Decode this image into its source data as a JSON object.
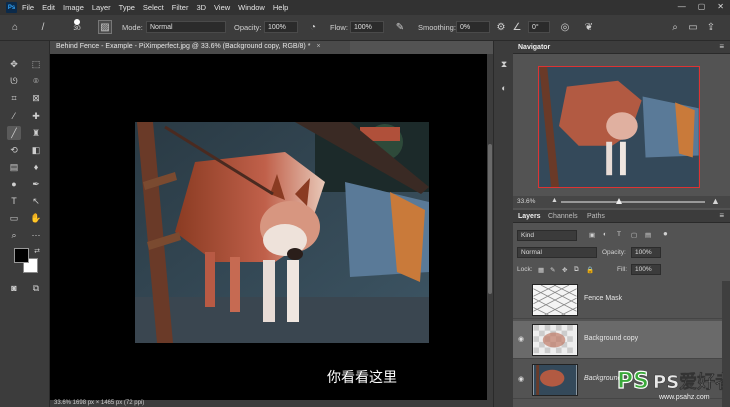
{
  "menubar": {
    "logo": "Ps",
    "items": [
      "File",
      "Edit",
      "Image",
      "Layer",
      "Type",
      "Select",
      "Filter",
      "3D",
      "View",
      "Window",
      "Help"
    ]
  },
  "options": {
    "brush_size": "30",
    "mode_label": "Mode:",
    "mode_value": "Normal",
    "opacity_label": "Opacity:",
    "opacity_value": "100%",
    "flow_label": "Flow:",
    "flow_value": "100%",
    "smoothing_label": "Smoothing:",
    "smoothing_value": "0%",
    "angle_value": "0°"
  },
  "document": {
    "tab_title": "Behind Fence - Example - PiXimperfect.jpg @ 33.6% (Background copy, RGB/8) *",
    "close": "×",
    "status": "33.6%   1698 px × 1465 px (72 ppi)"
  },
  "subtitle": "你看看这里",
  "navigator": {
    "tab": "Navigator",
    "zoom": "33.6%"
  },
  "layers_panel": {
    "tabs": [
      "Layers",
      "Channels",
      "Paths"
    ],
    "kind_label": "Kind",
    "blend_mode": "Normal",
    "opacity_label": "Opacity:",
    "opacity_value": "100%",
    "lock_label": "Lock:",
    "fill_label": "Fill:",
    "fill_value": "100%",
    "layers": [
      {
        "name": "Fence Mask",
        "visible": false,
        "selected": false
      },
      {
        "name": "Background copy",
        "visible": true,
        "selected": true
      },
      {
        "name": "Background",
        "visible": true,
        "selected": false
      }
    ]
  },
  "watermark": {
    "text": "PS爱好者",
    "url": "www.psahz.com"
  },
  "colors": {
    "fg": "#000000",
    "bg": "#ffffff",
    "accent": "#31a8ff"
  }
}
